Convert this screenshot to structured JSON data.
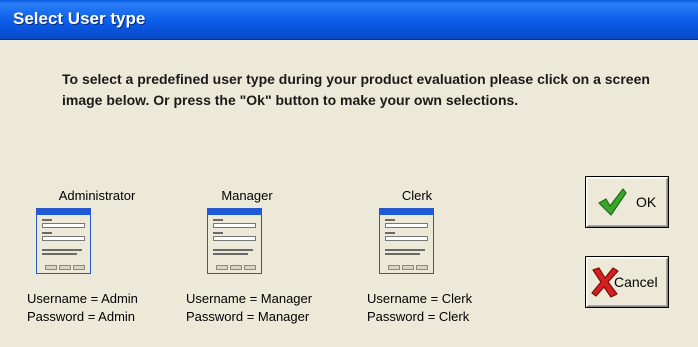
{
  "window": {
    "title": "Select User type"
  },
  "instructions": "To select a predefined user type during your product evaluation please click on a screen image below. Or press the \"Ok\" button to make your own selections.",
  "user_types": [
    {
      "title": "Administrator",
      "username_line": "Username = Admin",
      "password_line": "Password = Admin"
    },
    {
      "title": "Manager",
      "username_line": "Username = Manager",
      "password_line": "Password = Manager"
    },
    {
      "title": "Clerk",
      "username_line": "Username = Clerk",
      "password_line": "Password = Clerk"
    }
  ],
  "buttons": {
    "ok_label": "OK",
    "cancel_label": "Cancel"
  },
  "icons": {
    "ok": "green-check-icon",
    "cancel": "red-x-icon"
  },
  "colors": {
    "titlebar": "#0c5ce8",
    "background": "#ece9d8",
    "check": "#3aa52a",
    "x": "#d61f1f"
  }
}
